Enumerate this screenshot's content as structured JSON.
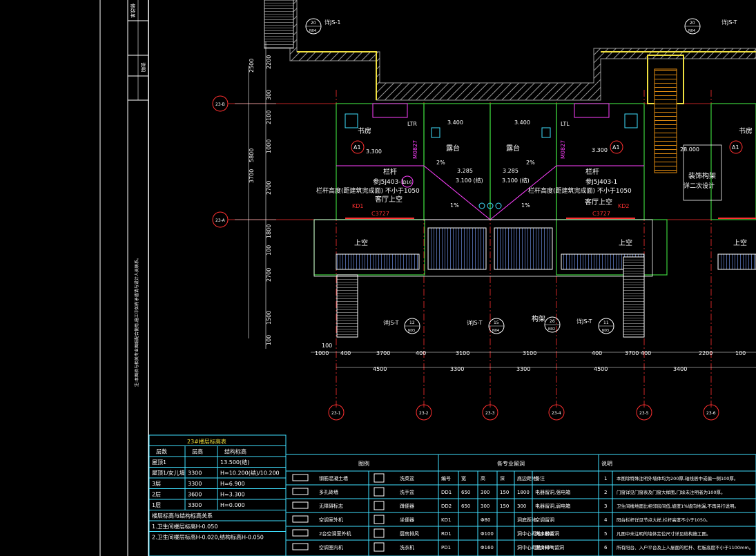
{
  "dims_left": [
    "2500",
    "2200",
    "300",
    "2100",
    "1000",
    "5800",
    "3700",
    "2700",
    "1800",
    "100",
    "2700",
    "1500",
    "100"
  ],
  "dims_bottom_1": [
    "100",
    "1000",
    "400",
    "3700",
    "400",
    "3100",
    "3100",
    "400",
    "3700",
    "400",
    "2200",
    "100"
  ],
  "dims_bottom_2": [
    "4500",
    "3300",
    "3300",
    "4500",
    "3400"
  ],
  "axis_bubbles": [
    "23-1",
    "23-2",
    "23-3",
    "23-4",
    "23-5",
    "23-6"
  ],
  "row_bubbles": [
    "23-B",
    "23-A"
  ],
  "rooms": {
    "study_l": "书房",
    "study_r": "书房",
    "terrace_l": "露台",
    "terrace_r": "露台",
    "above_void_l": "上空",
    "above_void_r": "上空",
    "above_void_rr": "上空",
    "living_void_l": "客厅上空",
    "living_void_r": "客厅上空",
    "railing_l": "栏杆",
    "railing_r": "栏杆",
    "railing_note_l": "栏杆高度(距建筑完成面) 不小于1050",
    "railing_note_r": "栏杆高度(距建筑完成面) 不小于1050",
    "ref_l": "参J5J403-1",
    "ref_r": "参J5J403-1",
    "deco_frame": "装饰构架",
    "deco_note": "详二次设计",
    "frame": "构架"
  },
  "elev": {
    "e1": "3.400",
    "e2": "3.400",
    "e3": "3.285",
    "e4": "3.285",
    "e5": "3.100 (结)",
    "e6": "3.100 (结)",
    "e7": "3.300",
    "e8": "3.300",
    "e9": "28.000"
  },
  "tags": {
    "a1": "A1",
    "c1": "C3727",
    "c2": "C3727",
    "kd1": "KD1",
    "kd2": "KD2",
    "m1": "M0827",
    "m2": "M0827",
    "ltr": "LTR",
    "ltl": "LTL",
    "jsT": "详JS-T",
    "js1": "详JS-1",
    "pct": "2%",
    "pct1": "1%",
    "d16": "D16"
  },
  "section_bubbles": [
    {
      "n": "20",
      "s": "N04"
    },
    {
      "n": "20",
      "s": "N04"
    },
    {
      "n": "12",
      "s": "N03"
    },
    {
      "n": "15",
      "s": "N04"
    },
    {
      "n": "26",
      "s": "N02"
    },
    {
      "n": "11",
      "s": "N03"
    }
  ],
  "floor_table": {
    "title": "23#楼层标高表",
    "headers": [
      "层数",
      "层高",
      "结构标高"
    ],
    "rows": [
      [
        "屋顶1",
        "",
        "13.500(结)"
      ],
      [
        "屋顶1/女儿墙",
        "3300",
        "H=10.200(结)/10.200"
      ],
      [
        "3层",
        "3300",
        "H=6.900"
      ],
      [
        "2层",
        "3600",
        "H=3.300"
      ],
      [
        "1层",
        "3300",
        "H=0.000"
      ]
    ],
    "note_title": "楼层标高与结构标高关系",
    "notes": [
      "1.卫生间楼层标高H-0.050",
      "2.卫生间楼层标高H-0.020,结构标高H-0.050"
    ]
  },
  "legend": {
    "title": "图例",
    "items": [
      [
        "钢筋混凝土墙",
        "洗菜盆"
      ],
      [
        "多孔砖墙",
        "洗手盆"
      ],
      [
        "无障碍标志",
        "蹲便器"
      ],
      [
        "空调室外机",
        "坐便器"
      ],
      [
        "2台空调室外机",
        "厨房排风"
      ],
      [
        "空调室内机",
        "洗衣机"
      ]
    ]
  },
  "hole_table": {
    "title": "各专业留洞",
    "headers": [
      "编号",
      "宽",
      "高",
      "深",
      "底边距地",
      "备注"
    ],
    "rows": [
      [
        "DD1",
        "650",
        "300",
        "150",
        "1800",
        "电器留洞,强电箱"
      ],
      [
        "DD2",
        "650",
        "300",
        "150",
        "300",
        "电器留洞,弱电箱"
      ],
      [
        "KD1",
        "",
        "Φ80",
        "",
        "洞底距地",
        "空调留洞"
      ],
      [
        "RD1",
        "",
        "Φ100",
        "",
        "洞中心距地2650",
        "热水器留洞"
      ],
      [
        "PD1",
        "",
        "Φ160",
        "",
        "洞中心距地2650",
        "厨房排气留洞"
      ]
    ]
  },
  "notes_table": {
    "title": "说明",
    "rows": [
      [
        "1",
        "本图除特殊注明外墙体均为200厚,轴线居中或偏一侧100厚。"
      ],
      [
        "2",
        "门窗详见门窗表及门窗大样图,门垛未注明者为100厚。"
      ],
      [
        "3",
        "卫生间楼地面比相邻房间低,坡度1%坡向地漏,不再另行说明。"
      ],
      [
        "4",
        "阳台栏杆详见节点大样,栏杆高度不小于1050。"
      ],
      [
        "5",
        "凡图中未注明的墙体定位尺寸详见结构施工图。"
      ],
      [
        "6",
        "所有阳台、入户平台及上人屋面的栏杆、栏板高度不小于1100mm。"
      ]
    ]
  },
  "titleblock_left": [
    "修改单",
    "说明"
  ],
  "vertical_note": "注:本图须与相关专业图纸配合使用,施工中如有矛盾请与设计人员联系。"
}
